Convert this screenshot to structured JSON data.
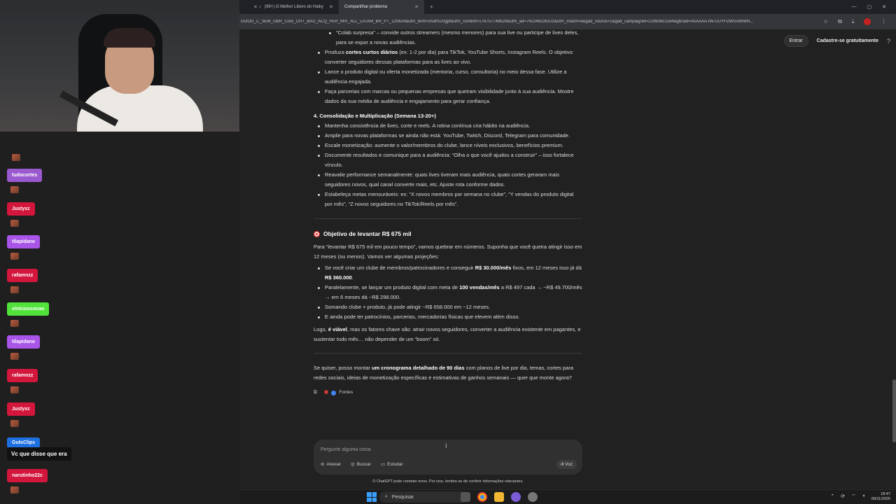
{
  "browser": {
    "tabs": [
      {
        "label": "(99+) O Melhor Libero do Haiky",
        "active": false
      },
      {
        "label": "Compartilhar problema",
        "active": true
      }
    ],
    "url": "GOOG_C_SEM_GBR_Core_CHT_BAU_ACQ_PER_MIX_ALL_LATAM_BR_PT_120624&utm_term=chat%20gpt&utm_content=176757749629&utm_ad=742246226102&utm_match=e&gad_source=1&gad_campaignid=21990631164&gbraid=0AAAAA-IW-UUYFOWSAWWN..."
  },
  "auth": {
    "login": "Entrar",
    "signup": "Cadastre-se gratuitamente"
  },
  "chat_overlay": {
    "users": [
      "tudocortes",
      "Justyxz",
      "tilapidano",
      "rafamnzz",
      "viniciuscocao",
      "tilapidano",
      "rafamnzz",
      "Justyxz",
      "GutsClips",
      "narutinho22c"
    ],
    "message": "Vc que disse que era"
  },
  "content": {
    "top_bullets": [
      "“Colab surpresa” – convide outros streamers (mesmo menores) para sua live ou participe de lives deles, para se expor a novas audiências.",
      "cortes curtos diários",
      "Lance o produto digital ou oferta monetizada (mentoria, curso, consultoria) no meio dessa fase. Utilize a audiência engajada.",
      "Faça parcerias com marcas ou pequenas empresas que queiram visibilidade junto à sua audiência. Mostre dados da sua média de audiência e engajamento para gerar confiança."
    ],
    "bullet2_pre": "Produza ",
    "bullet2_post": " (ex: 1-2 por dia) para TikTok, YouTube Shorts, Instagram Reels. O objetivo: converter seguidores dessas plataformas para as lives ao vivo.",
    "section4_title": "4. Consolidação e Multiplicação (Semana 13-20+)",
    "section4_bullets": [
      "Mantenha consistência de lives, corte e reels. A rotina contínua cria hábito na audiência.",
      "Amplie para novas plataformas se ainda não está: YouTube, Twitch, Discord, Telegram para comunidade.",
      "Escale monetização: aumente o valor/membros do clube, lance níveis exclusivos, benefícios premium.",
      "Documente resultados e comunique para a audiência: “Olha o que você ajudou a construir” – isso fortalece vínculo.",
      "Reavalie performance semanalmente: quais lives tiveram mais audiência, quais cortes geraram mais seguidores novos, qual canal converte mais, etc. Ajuste rota conforme dados.",
      "Estabeleça metas mensuráveis: ex: “X novos membros por semana no clube”, “Y vendas do produto digital por mês”, “Z novos seguidores no TikTok/Reels por mês”."
    ],
    "objective_title": "Objetivo de levantar R$ 675 mil",
    "objective_intro": "Para “levantar R$ 675 mil em pouco tempo”, vamos quebrar em números. Suponha que você queira atingir isso em 12 meses (ou menos). Vamos ver algumas projeções:",
    "obj_b1": {
      "a": "Se você criar um clube de membros/patrocinadores e conseguir ",
      "b": "R$ 30.000/mês",
      "c": " fixos, em 12 meses isso já dá ",
      "d": "R$ 360.000",
      "e": "."
    },
    "obj_b2": {
      "a": "Paralelamente, se lançar um produto digital com meta de ",
      "b": "100 vendas/mês",
      "c": " a R$ 497 cada → ~R$ 49.700/mês → em 6 meses dá ~R$ 298.000."
    },
    "obj_b3": "Somando clube + produto, já pode atingir ~R$ 658.000 em ~12 meses.",
    "obj_b4": "E ainda pode ter patrocínios, parcerias, mercadorias físicas que elevem além disso.",
    "conclusion": {
      "a": "Logo, ",
      "b": "é viável",
      "c": ", mas os fatores chave são: atrair novos seguidores, converter a audiência existente em pagantes, e sustentar todo mês… não depender de um “boom” só."
    },
    "offer": {
      "a": "Se quiser, posso montar ",
      "b": "um cronograma detalhado de 90 dias",
      "c": " com planos de live por dia, temas, cortes para redes sociais, ideias de monetização específicas e estimativas de ganhos semanais — quer que monte agora?"
    },
    "sources_label": "Fontes"
  },
  "composer": {
    "placeholder": "Pergunte alguma coisa",
    "attach": "Anexar",
    "search": "Buscar",
    "study": "Estudar",
    "voice": "Voz"
  },
  "disclaimer": "O ChatGPT pode cometer erros. Por isso, lembre-se de conferir informações relevantes.",
  "taskbar": {
    "search": "Pesquisar",
    "time": "18:47",
    "date": "09/11/2025"
  }
}
